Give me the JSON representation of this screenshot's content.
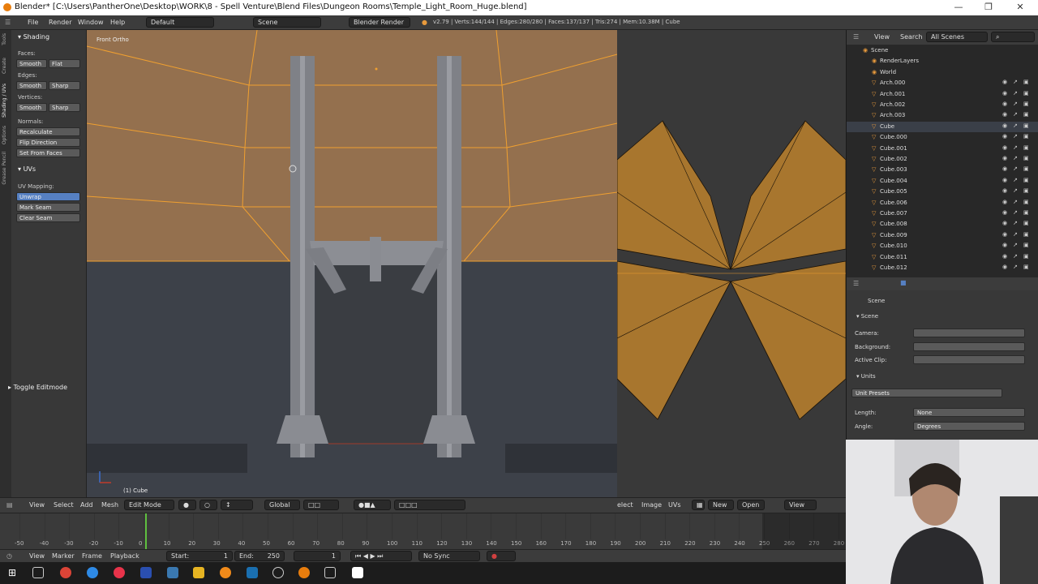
{
  "window": {
    "title": "Blender* [C:\\Users\\PantherOne\\Desktop\\WORK\\8 - Spell Venture\\Blend Files\\Dungeon Rooms\\Temple_Light_Room_Huge.blend]"
  },
  "info_bar": {
    "menus": [
      "File",
      "Render",
      "Window",
      "Help"
    ],
    "layout": "Default",
    "scene": "Scene",
    "engine": "Blender Render",
    "stats": "v2.79 | Verts:144/144 | Edges:280/280 | Faces:137/137 | Tris:274 | Mem:10.38M | Cube"
  },
  "tool_shelf": {
    "tabs": [
      "Tools",
      "Create",
      "Shading / UVs",
      "Options",
      "Grease Pencil"
    ],
    "shading_panel": "Shading",
    "faces_label": "Faces:",
    "edges_label": "Edges:",
    "vertices_label": "Vertices:",
    "normals_label": "Normals:",
    "smooth": "Smooth",
    "flat": "Flat",
    "sharp": "Sharp",
    "recalculate": "Recalculate",
    "flip_direction": "Flip Direction",
    "set_from_faces": "Set From Faces",
    "uvs_panel": "UVs",
    "uv_mapping_label": "UV Mapping:",
    "unwrap": "Unwrap",
    "mark_seam": "Mark Seam",
    "clear_seam": "Clear Seam",
    "toggle_editmode": "Toggle Editmode"
  },
  "viewport_3d": {
    "view_label": "Front Ortho",
    "object_label": "(1) Cube",
    "header": {
      "menus": [
        "View",
        "Select",
        "Add",
        "Mesh"
      ],
      "mode": "Edit Mode",
      "orientation": "Global"
    }
  },
  "uv_editor": {
    "header": {
      "menus": [
        "elect",
        "Image",
        "UVs"
      ],
      "new": "New",
      "open": "Open",
      "view": "View"
    }
  },
  "outliner": {
    "view": "View",
    "search": "Search",
    "filter": "All Scenes",
    "items": [
      {
        "name": "Scene",
        "indent": 0
      },
      {
        "name": "RenderLayers",
        "indent": 1
      },
      {
        "name": "World",
        "indent": 1
      },
      {
        "name": "Arch.000",
        "indent": 1
      },
      {
        "name": "Arch.001",
        "indent": 1
      },
      {
        "name": "Arch.002",
        "indent": 1
      },
      {
        "name": "Arch.003",
        "indent": 1
      },
      {
        "name": "Cube",
        "indent": 1
      },
      {
        "name": "Cube.000",
        "indent": 1
      },
      {
        "name": "Cube.001",
        "indent": 1
      },
      {
        "name": "Cube.002",
        "indent": 1
      },
      {
        "name": "Cube.003",
        "indent": 1
      },
      {
        "name": "Cube.004",
        "indent": 1
      },
      {
        "name": "Cube.005",
        "indent": 1
      },
      {
        "name": "Cube.006",
        "indent": 1
      },
      {
        "name": "Cube.007",
        "indent": 1
      },
      {
        "name": "Cube.008",
        "indent": 1
      },
      {
        "name": "Cube.009",
        "indent": 1
      },
      {
        "name": "Cube.010",
        "indent": 1
      },
      {
        "name": "Cube.011",
        "indent": 1
      },
      {
        "name": "Cube.012",
        "indent": 1
      }
    ]
  },
  "properties": {
    "context": "Scene",
    "scene_panel": "Scene",
    "camera_label": "Camera:",
    "background_label": "Background:",
    "active_clip_label": "Active Clip:",
    "units_panel": "Units",
    "unit_presets": "Unit Presets",
    "length_label": "Length:",
    "length_value": "None",
    "angle_label": "Angle:",
    "angle_value": "Degrees"
  },
  "timeline": {
    "ticks": [
      "-50",
      "-40",
      "-30",
      "-20",
      "-10",
      "0",
      "10",
      "20",
      "30",
      "40",
      "50",
      "60",
      "70",
      "80",
      "90",
      "100",
      "110",
      "120",
      "130",
      "140",
      "150",
      "160",
      "170",
      "180",
      "190",
      "200",
      "210",
      "220",
      "230",
      "240",
      "250",
      "260",
      "270",
      "280"
    ],
    "menus": [
      "View",
      "Marker",
      "Frame",
      "Playback"
    ],
    "start_label": "Start:",
    "start_value": "1",
    "end_label": "End:",
    "end_value": "250",
    "current_frame": "1",
    "sync": "No Sync"
  },
  "colors": {
    "accent": "#e89a3c",
    "selected": "#5680c2",
    "wall": "#94704e",
    "floor": "#3d4149"
  }
}
